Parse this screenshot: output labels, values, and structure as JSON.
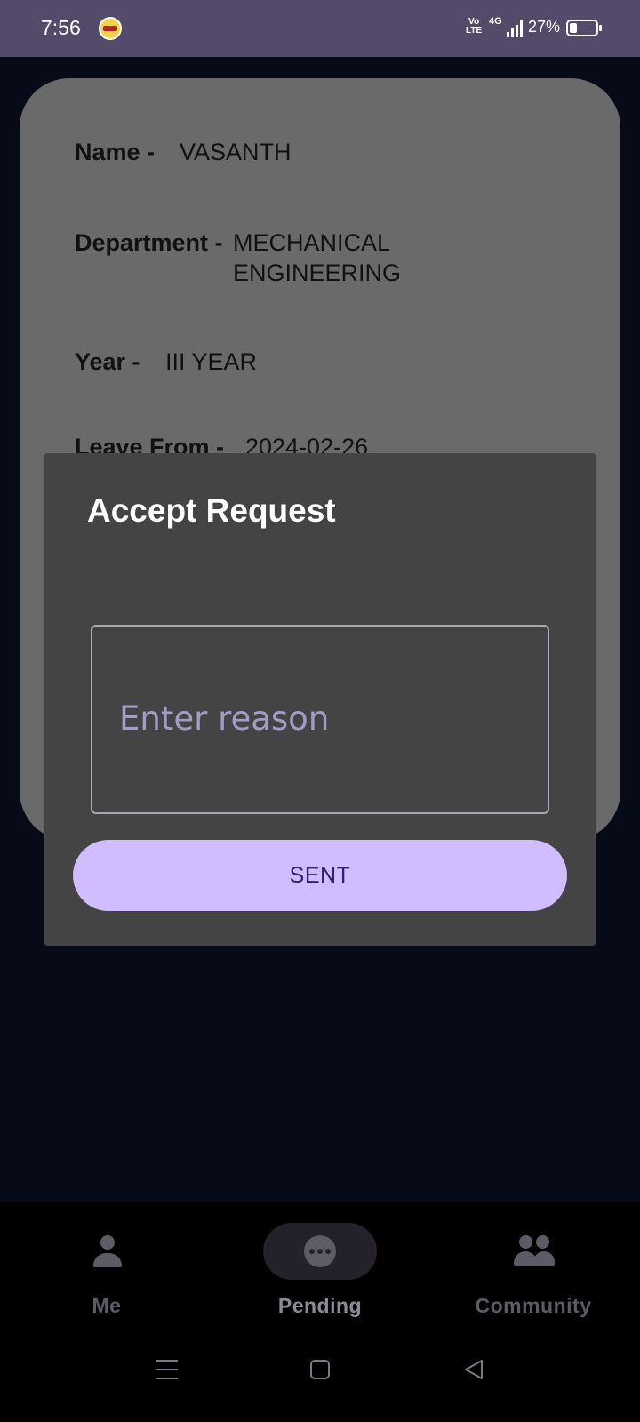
{
  "status_bar": {
    "time": "7:56",
    "volte": "Vo\nLTE",
    "network": "4G",
    "battery_percent": "27%",
    "battery_level": 0.27
  },
  "details": {
    "name_label": "Name -",
    "name_value": "VASANTH",
    "department_label": "Department -",
    "department_value": "MECHANICAL ENGINEERING",
    "year_label": "Year -",
    "year_value": "III YEAR",
    "leave_from_label": "Leave From -",
    "leave_from_value": "2024-02-26"
  },
  "dialog": {
    "title": "Accept Request",
    "reason_placeholder": "Enter reason",
    "reason_value": "",
    "submit_label": "SENT"
  },
  "bottom_nav": {
    "items": [
      {
        "label": "Me",
        "icon": "person-icon"
      },
      {
        "label": "Pending",
        "icon": "more-horiz-icon",
        "active": true
      },
      {
        "label": "Community",
        "icon": "group-icon"
      }
    ]
  },
  "system_nav": {
    "icons": [
      "menu-icon",
      "home-icon",
      "back-icon"
    ]
  }
}
